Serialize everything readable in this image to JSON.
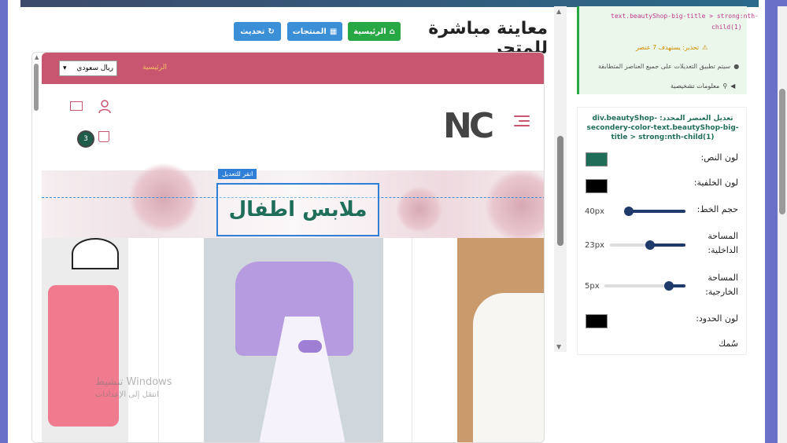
{
  "header": {
    "title": "معاينة مباشرة للمتجر",
    "buttons": {
      "home": "الرئيسية",
      "products": "المنتجات",
      "refresh": "تحديث"
    }
  },
  "preview": {
    "currency_select": "ريال سعودي",
    "pink_link": "الرئيسية",
    "logo_text": "NC",
    "cart_count": "3",
    "edit_tag": "انقر للتعديل",
    "banner_title": "ملابس اطفال",
    "watermark_title": "تنشيط Windows",
    "watermark_sub": "انتقل إلى الإعدادات"
  },
  "side_panel": {
    "code_lines": [
      "text.beautyShop-big-title > strong:nth-",
      "child(1)"
    ],
    "warning": "تحذير: يستهدف 7 عنصر",
    "hint": "سيتم تطبيق التعديلات على جميع العناصر المتطابقة",
    "diagnostics": "معلومات تشخيصية",
    "edit_heading": "تعديل العنصر المحدد: div.beautyShop-secondery-color-text.beautyShop-big-title > strong:nth-child(1)",
    "fields": {
      "text_color_label": "لون النص:",
      "bg_color_label": "لون الخلفية:",
      "font_size_label": "حجم الخط:",
      "font_size_value": "40px",
      "padding_label": "المساحة الداخلية:",
      "padding_value": "23px",
      "margin_label": "المساحة الخارجية:",
      "margin_value": "5px",
      "border_color_label": "لون الحدود:",
      "thickness_label": "سُمك"
    },
    "colors": {
      "text": "#1f6e5a",
      "background": "#000000",
      "border": "#000000"
    }
  }
}
